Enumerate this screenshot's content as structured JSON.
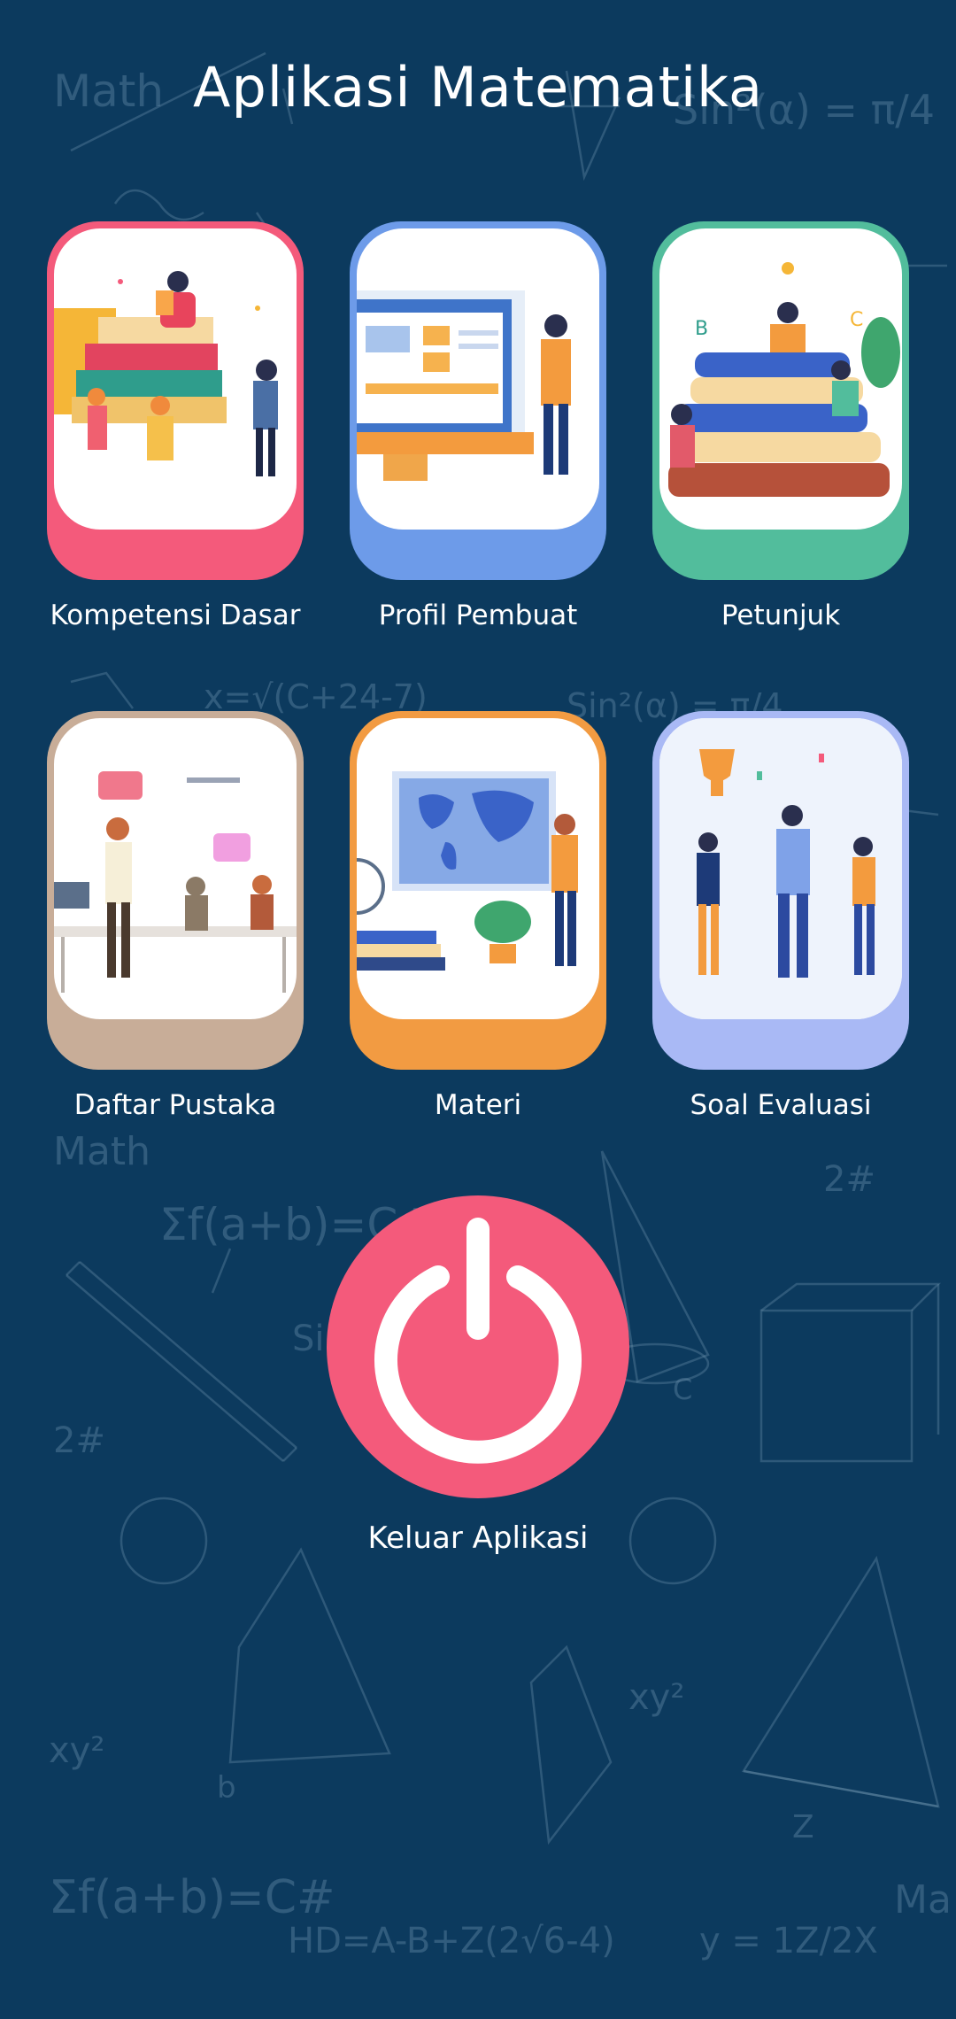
{
  "app": {
    "title": "Aplikasi Matematika"
  },
  "menu": {
    "items": [
      {
        "label": "Kompetensi Dasar",
        "accent": "#f45a7b"
      },
      {
        "label": "Profil Pembuat",
        "accent": "#6d9be9"
      },
      {
        "label": "Petunjuk",
        "accent": "#52bd9c"
      },
      {
        "label": "Daftar Pustaka",
        "accent": "#c8ad98"
      },
      {
        "label": "Materi",
        "accent": "#f29b42"
      },
      {
        "label": "Soal Evaluasi",
        "accent": "#a9b9f5"
      }
    ]
  },
  "exit": {
    "label": "Keluar Aplikasi",
    "color": "#f45a7b",
    "icon": "power-icon"
  },
  "colors": {
    "background": "#0c3a5e",
    "chalk": "#8fb0c8"
  },
  "background": {
    "chalk_texts": [
      "Math",
      "Sin²(α) = π/4",
      "x=√(C+24-7)",
      "Sin²(α) = π/4",
      "Math",
      "Σf(a+b)=C#",
      "2#",
      "2#",
      "Sin",
      "xy²",
      "xy²",
      "Σf(a+b)=C#",
      "HD=A-B+Z(2√6-4)",
      "y = 1Z/2X",
      "Ma",
      "C",
      "b",
      "Z"
    ]
  }
}
